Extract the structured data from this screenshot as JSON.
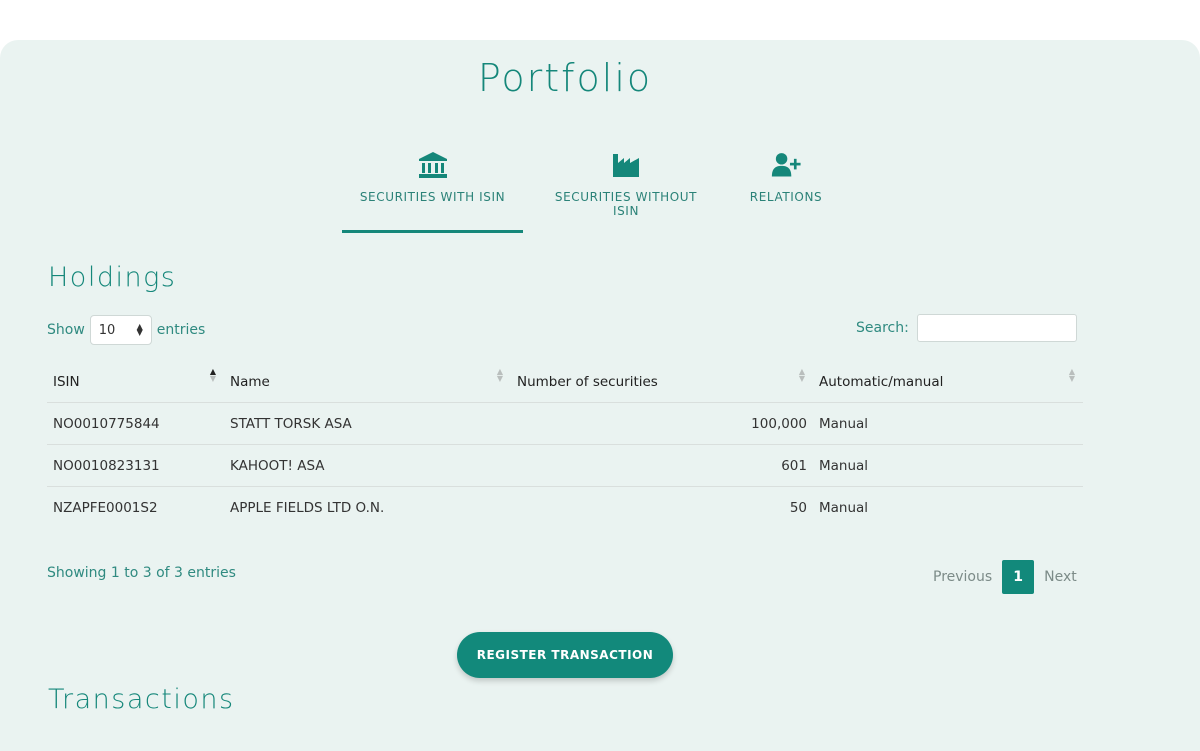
{
  "page": {
    "title": "Portfolio"
  },
  "tabs": [
    {
      "label": "SECURITIES WITH ISIN",
      "icon": "bank-icon",
      "active": true
    },
    {
      "label": "SECURITIES WITHOUT ISIN",
      "icon": "factory-icon",
      "active": false
    },
    {
      "label": "RELATIONS",
      "icon": "add-user-icon",
      "active": false
    }
  ],
  "holdings": {
    "heading": "Holdings",
    "show_label": "Show",
    "entries_label": "entries",
    "page_length": "10",
    "search_label": "Search:",
    "search_value": "",
    "columns": [
      "ISIN",
      "Name",
      "Number of securities",
      "Automatic/manual"
    ],
    "rows": [
      {
        "isin": "NO0010775844",
        "name": "STATT TORSK ASA",
        "count": "100,000",
        "mode": "Manual"
      },
      {
        "isin": "NO0010823131",
        "name": "KAHOOT! ASA",
        "count": "601",
        "mode": "Manual"
      },
      {
        "isin": "NZAPFE0001S2",
        "name": "APPLE FIELDS LTD O.N.",
        "count": "50",
        "mode": "Manual"
      }
    ],
    "info": "Showing 1 to 3 of 3 entries",
    "pager": {
      "previous": "Previous",
      "current": "1",
      "next": "Next"
    }
  },
  "actions": {
    "register_label": "REGISTER TRANSACTION"
  },
  "transactions": {
    "heading": "Transactions"
  },
  "colors": {
    "accent": "#12897b",
    "panel_bg": "#eaf3f1",
    "text_teal": "#2f8a80"
  }
}
